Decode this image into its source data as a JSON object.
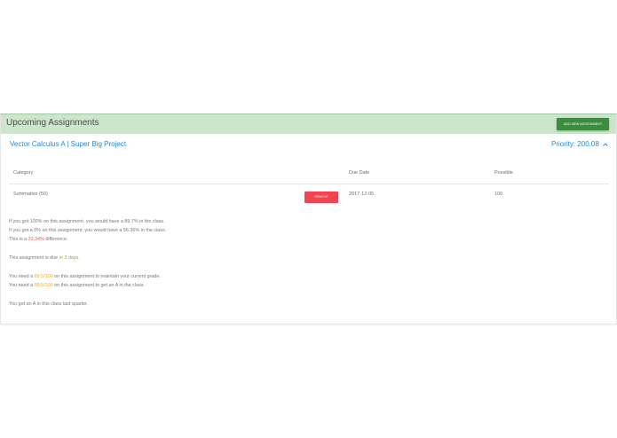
{
  "header": {
    "title": "Upcoming Assignments",
    "add_button": "ADD NEW ASSIGNMENT"
  },
  "assignment": {
    "title": "Vector Calculus A | Super Big Project",
    "priority": "Priority: 200.08",
    "table": {
      "headers": [
        "Category",
        "Due Date",
        "Possible"
      ],
      "row": {
        "category": "Summative (50)",
        "remove_label": "REMOVE",
        "due_date": "2017-12-05",
        "possible": "100"
      }
    },
    "info": {
      "line1": "If you got 100% on this assignment, you would have a 89.7% in the class.",
      "line2": "If you got a 0% on this assignment, you would have a 56.36% in the class.",
      "line3_pre": "This is a ",
      "line3_value": "33.34%",
      "line3_post": " difference.",
      "due_pre": "This assignment is due ",
      "due_value": "in 3 days.",
      "need1_pre": "You need a ",
      "need1_value": "69.5/100",
      "need1_post": " on this assignment to maintain your current grade.",
      "need2_pre": "You need a ",
      "need2_value": "89.5/100",
      "need2_post": " on this assignment to get an A in the class.",
      "last_quarter": "You got an A in this class last quarter."
    }
  },
  "colors": {
    "header_bg": "#cce6cc",
    "add_button": "#388e3c",
    "link_blue": "#1e88e5",
    "remove_red": "#f44350",
    "difference_red": "#f05a5a",
    "due_green": "#7cb342",
    "need_orange": "#f5a623"
  },
  "icons": {
    "collapse": "chevron-up-icon"
  }
}
